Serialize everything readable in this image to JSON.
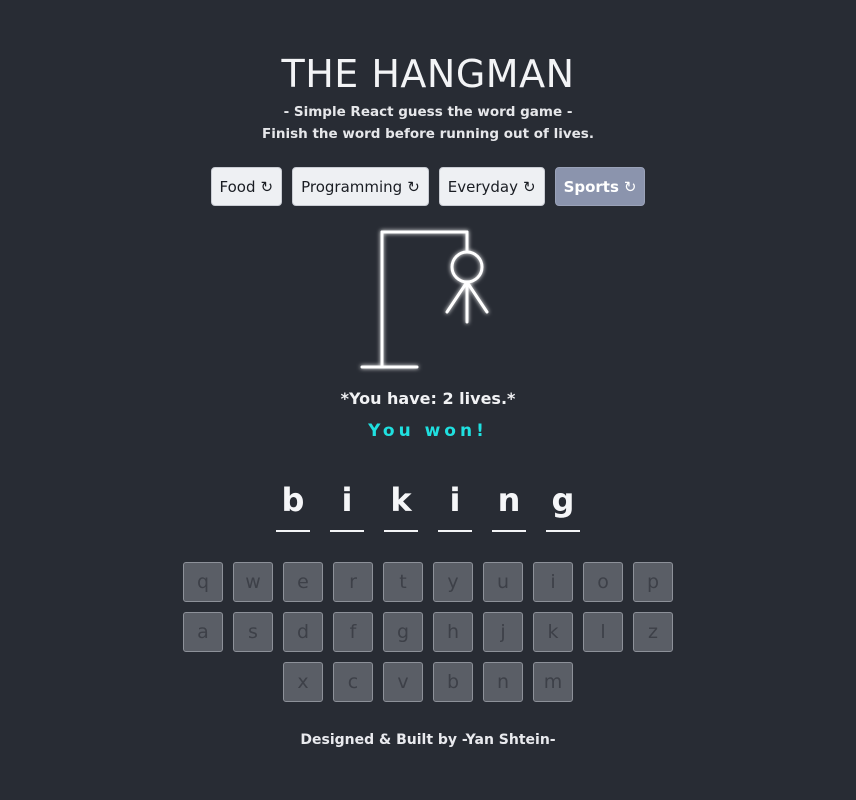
{
  "header": {
    "title": "THE HANGMAN",
    "subtitle_1": "- Simple React guess the word game -",
    "subtitle_2": "Finish the word before running out of lives."
  },
  "categories": [
    {
      "label": "Food",
      "icon": "↻",
      "active": false
    },
    {
      "label": "Programming",
      "icon": "↻",
      "active": false
    },
    {
      "label": "Everyday",
      "icon": "↻",
      "active": false
    },
    {
      "label": "Sports",
      "icon": "↻",
      "active": true
    }
  ],
  "game": {
    "lives_text": "*You have: 2 lives.*",
    "status_text": "You won!",
    "word_letters": [
      "b",
      "i",
      "k",
      "i",
      "n",
      "g"
    ]
  },
  "keyboard": {
    "row_1": [
      "q",
      "w",
      "e",
      "r",
      "t",
      "y",
      "u",
      "i",
      "o",
      "p"
    ],
    "row_2": [
      "a",
      "s",
      "d",
      "f",
      "g",
      "h",
      "j",
      "k",
      "l",
      "z"
    ],
    "row_3": [
      "x",
      "c",
      "v",
      "b",
      "n",
      "m"
    ]
  },
  "footer": {
    "credit": "Designed & Built by -Yan Shtein-"
  },
  "colors": {
    "background": "#282c34",
    "status_accent": "#1fe0e0",
    "active_category": "#8b94ad",
    "key_disabled": "#5a5e66"
  }
}
